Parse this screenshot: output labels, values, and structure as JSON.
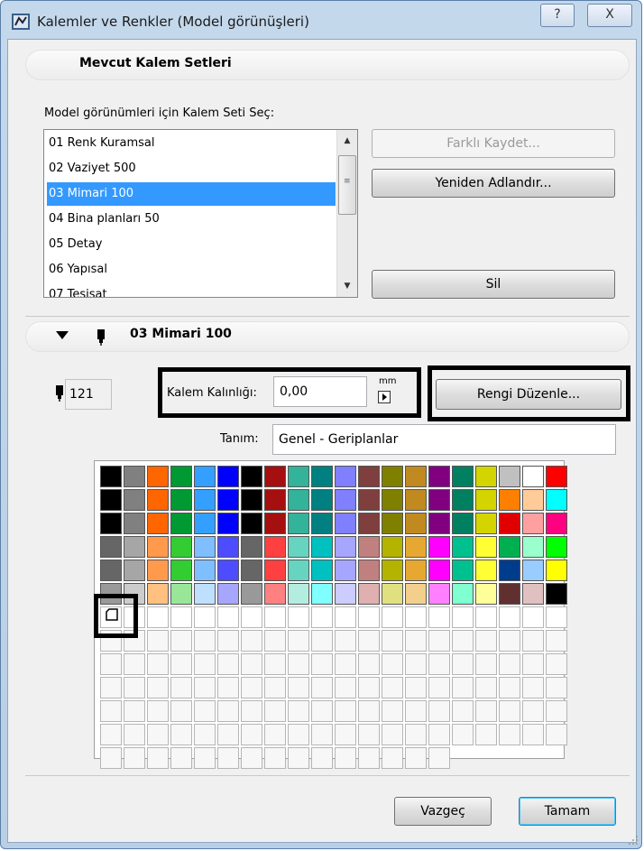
{
  "window": {
    "title": "Kalemler ve Renkler (Model görünüşleri)",
    "help_label": "?",
    "close_label": "X"
  },
  "pen_sets": {
    "section_title": "Mevcut Kalem Setleri",
    "select_label": "Model görünümleri için Kalem Seti Seç:",
    "items": [
      {
        "label": "01 Renk Kuramsal"
      },
      {
        "label": "02 Vaziyet 500"
      },
      {
        "label": "03 Mimari 100",
        "selected": true
      },
      {
        "label": "04 Bina planları 50"
      },
      {
        "label": "05 Detay"
      },
      {
        "label": "06 Yapısal"
      },
      {
        "label": "07 Tesisat"
      }
    ],
    "save_as_label": "Farklı Kaydet...",
    "rename_label": "Yeniden Adlandır...",
    "delete_label": "Sil"
  },
  "selected_set": {
    "title": "03 Mimari 100",
    "pen_number": "121",
    "thickness_label": "Kalem Kalınlığı:",
    "thickness_value": "0,00",
    "unit_label": "mm",
    "edit_color_label": "Rengi Düzenle...",
    "description_label": "Tanım:",
    "description_value": "Genel - Geriplanlar"
  },
  "palette": {
    "rows": [
      [
        "#000000",
        "#808080",
        "#ff6600",
        "#009933",
        "#33a0ff",
        "#0000ff",
        "#000000",
        "#a50f0f",
        "#33b39a",
        "#008080",
        "#8080ff",
        "#7f3f3f",
        "#808000",
        "#c08a20",
        "#800080",
        "#008060",
        "#d4d400",
        "#c0c0c0",
        "#ffffff",
        "#ff0000"
      ],
      [
        "#000000",
        "#808080",
        "#ff6600",
        "#009933",
        "#33a0ff",
        "#0000ff",
        "#000000",
        "#a50f0f",
        "#33b39a",
        "#008080",
        "#8080ff",
        "#7f3f3f",
        "#808000",
        "#c08a20",
        "#800080",
        "#008060",
        "#d4d400",
        "#ff8000",
        "#ffcc99",
        "#00ffff"
      ],
      [
        "#000000",
        "#808080",
        "#ff6600",
        "#009933",
        "#33a0ff",
        "#0000ff",
        "#000000",
        "#a50f0f",
        "#33b39a",
        "#008080",
        "#8080ff",
        "#7f3f3f",
        "#808000",
        "#c08a20",
        "#800080",
        "#008060",
        "#d4d400",
        "#e00000",
        "#ffa0a0",
        "#ff0080"
      ],
      [
        "#666666",
        "#a6a6a6",
        "#ff9a4d",
        "#33cc33",
        "#7fbfff",
        "#4d4dff",
        "#666666",
        "#ff4040",
        "#66d4c0",
        "#00c0c0",
        "#a6a6ff",
        "#c08080",
        "#b3b300",
        "#e6a830",
        "#ff00ff",
        "#00c090",
        "#ffff33",
        "#00b050",
        "#99ffcc",
        "#00ff00"
      ],
      [
        "#666666",
        "#a6a6a6",
        "#ff9a4d",
        "#33cc33",
        "#7fbfff",
        "#4d4dff",
        "#666666",
        "#ff4040",
        "#66d4c0",
        "#00c0c0",
        "#a6a6ff",
        "#c08080",
        "#b3b300",
        "#e6a830",
        "#ff00ff",
        "#00c090",
        "#ffff33",
        "#003c8c",
        "#99ccff",
        "#ffff00"
      ],
      [
        "#999999",
        "#cccccc",
        "#ffc080",
        "#99e699",
        "#bfdfff",
        "#a6a6ff",
        "#999999",
        "#ff8080",
        "#b3ede0",
        "#80ffff",
        "#ccccff",
        "#e0b0b0",
        "#e0e080",
        "#f2d08c",
        "#ff80ff",
        "#80ffd0",
        "#ffff99",
        "#603030",
        "#e0c0c0",
        "#000000"
      ]
    ],
    "white_rows": 1,
    "empty_rows": 6,
    "empty_last_row_count": 15
  },
  "footer": {
    "cancel_label": "Vazgeç",
    "ok_label": "Tamam"
  },
  "colors": {
    "selection": "#3399ff",
    "frame": "#b9cfe6"
  }
}
